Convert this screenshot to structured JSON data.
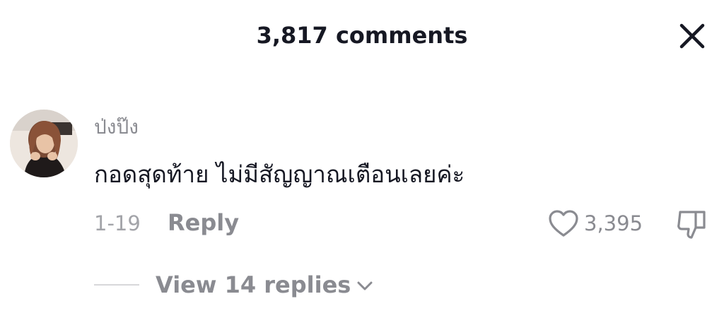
{
  "header": {
    "title": "3,817 comments"
  },
  "comment": {
    "username": "ป่งป๊ง",
    "text": "กอดสุดท้าย ไม่มีสัญญาณเตือนเลยค่ะ",
    "date": "1-19",
    "reply_label": "Reply",
    "like_count": "3,395",
    "view_replies_label": "View 14 replies"
  },
  "icons": {
    "close": "close-icon",
    "like": "heart-outline-icon",
    "dislike": "thumbs-down-icon",
    "expand": "chevron-down-icon"
  },
  "colors": {
    "primary_text": "#161823",
    "secondary_text": "#8a8b91",
    "muted_text": "#a3a4a9"
  }
}
